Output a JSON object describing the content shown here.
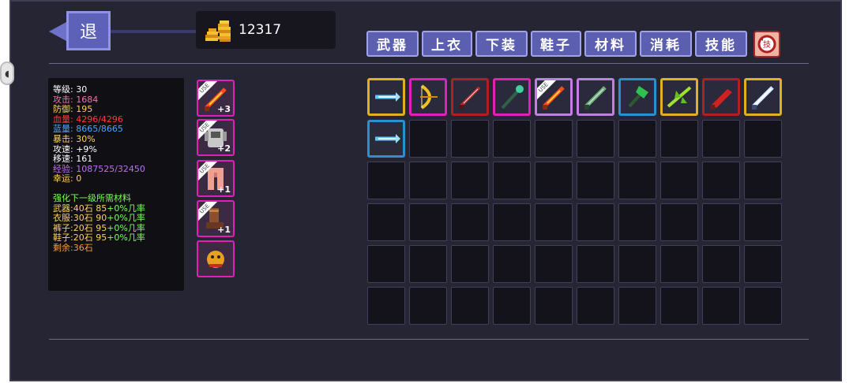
{
  "back": {
    "label": "退"
  },
  "coins": {
    "value": "12317"
  },
  "tabs": [
    {
      "label": "武器"
    },
    {
      "label": "上衣"
    },
    {
      "label": "下装"
    },
    {
      "label": "鞋子"
    },
    {
      "label": "材料"
    },
    {
      "label": "消耗"
    },
    {
      "label": "技能"
    }
  ],
  "refresh_button": {
    "label": "技"
  },
  "stats": [
    {
      "text": "等级: 30",
      "color": "#ffffff"
    },
    {
      "text": "攻击: 1684",
      "color": "#ff6fa0"
    },
    {
      "text": "防御: 195",
      "color": "#ffd35a"
    },
    {
      "text": "血量: 4296/4296",
      "color": "#ff3b3b"
    },
    {
      "text": "蓝量: 8665/8665",
      "color": "#4ea3ff"
    },
    {
      "text": "暴击: 30%",
      "color": "#ffd35a"
    },
    {
      "text": "攻速: +9%",
      "color": "#ffffff"
    },
    {
      "text": "移速: 161",
      "color": "#ffffff"
    },
    {
      "text": "经验: 1087525/32450",
      "color": "#c070f0"
    },
    {
      "text": "幸运: 0",
      "color": "#ffd35a"
    }
  ],
  "upgrade": {
    "title": "强化下一级所需材料",
    "rows": [
      {
        "prefix": "武器:40石 85",
        "rate": "+0%几率"
      },
      {
        "prefix": "衣服:30石 90",
        "rate": "+0%几率"
      },
      {
        "prefix": "裤子:20石 95",
        "rate": "+0%几率"
      },
      {
        "prefix": "鞋子:20石 95",
        "rate": "+0%几率"
      }
    ],
    "remaining": "剩余:36石"
  },
  "equipped": [
    {
      "icon": "flame-sword-icon",
      "plus": "+3",
      "use": "USE"
    },
    {
      "icon": "armor-icon",
      "plus": "+2",
      "use": "USE"
    },
    {
      "icon": "pants-icon",
      "plus": "+1",
      "use": "USE"
    },
    {
      "icon": "boots-icon",
      "plus": "+1",
      "use": "USE"
    },
    {
      "icon": "pet-icon",
      "plus": "",
      "use": ""
    }
  ],
  "inventory": [
    {
      "icon": "blue-spear-icon",
      "border": "#e0b020",
      "use": ""
    },
    {
      "icon": "golden-bow-icon",
      "border": "#e020b8",
      "use": ""
    },
    {
      "icon": "red-blade-icon",
      "border": "#b02020",
      "use": ""
    },
    {
      "icon": "jade-staff-icon",
      "border": "#e020b8",
      "use": ""
    },
    {
      "icon": "flame-sword-icon",
      "border": "#c080e0",
      "use": "USE"
    },
    {
      "icon": "green-sword-icon",
      "border": "#c080e0",
      "use": ""
    },
    {
      "icon": "emerald-axe-icon",
      "border": "#2a90d0",
      "use": ""
    },
    {
      "icon": "thorn-blade-icon",
      "border": "#e0b020",
      "use": ""
    },
    {
      "icon": "crimson-blade-icon",
      "border": "#b02020",
      "use": ""
    },
    {
      "icon": "silver-sword-icon",
      "border": "#e0b020",
      "use": ""
    },
    {
      "icon": "blue-spear-icon",
      "border": "#2a90d0",
      "use": ""
    }
  ]
}
